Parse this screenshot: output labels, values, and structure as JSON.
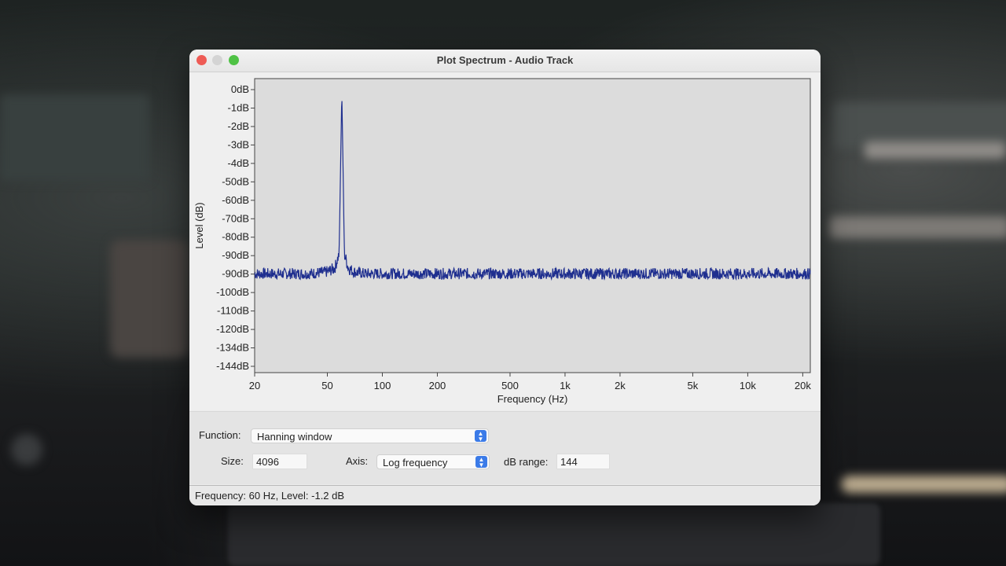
{
  "window": {
    "title": "Plot Spectrum - Audio Track"
  },
  "chart_data": {
    "type": "line",
    "xlabel": "Frequency (Hz)",
    "ylabel": "Level (dB)",
    "x_scale": "log",
    "xlim": [
      20,
      22000
    ],
    "x_ticks": [
      {
        "value": 20,
        "label": "20"
      },
      {
        "value": 50,
        "label": "50"
      },
      {
        "value": 100,
        "label": "100"
      },
      {
        "value": 200,
        "label": "200"
      },
      {
        "value": 500,
        "label": "500"
      },
      {
        "value": 1000,
        "label": "1k"
      },
      {
        "value": 2000,
        "label": "2k"
      },
      {
        "value": 5000,
        "label": "5k"
      },
      {
        "value": 10000,
        "label": "10k"
      },
      {
        "value": 20000,
        "label": "20k"
      }
    ],
    "y_tick_labels": [
      "0dB",
      "-1dB",
      "-2dB",
      "-3dB",
      "-4dB",
      "-50dB",
      "-60dB",
      "-70dB",
      "-80dB",
      "-90dB",
      "-90dB",
      "-100dB",
      "-110dB",
      "-120dB",
      "-134dB",
      "-144dB"
    ],
    "series": [
      {
        "color": "#1f2f8f",
        "x": [
          20,
          30,
          40,
          50,
          55,
          58,
          59,
          60,
          61,
          62,
          65,
          70,
          80,
          100,
          150,
          200,
          500,
          1000,
          2000,
          5000,
          10000,
          20000,
          22000
        ],
        "y": [
          -90,
          -90,
          -90,
          -89,
          -87,
          -80,
          -40,
          -1.2,
          -40,
          -80,
          -87,
          -89,
          -90,
          -90,
          -90,
          -90,
          -90,
          -90,
          -90,
          -90,
          -90,
          -90,
          -90
        ],
        "noise_db": 3
      }
    ],
    "grid": false,
    "legend": "none"
  },
  "controls": {
    "function_label": "Function:",
    "function_value": "Hanning window",
    "size_label": "Size:",
    "size_value": "4096",
    "axis_label": "Axis:",
    "axis_value": "Log frequency",
    "dbrange_label": "dB range:",
    "dbrange_value": "144"
  },
  "status": {
    "text": "Frequency: 60 Hz, Level: -1.2 dB"
  }
}
